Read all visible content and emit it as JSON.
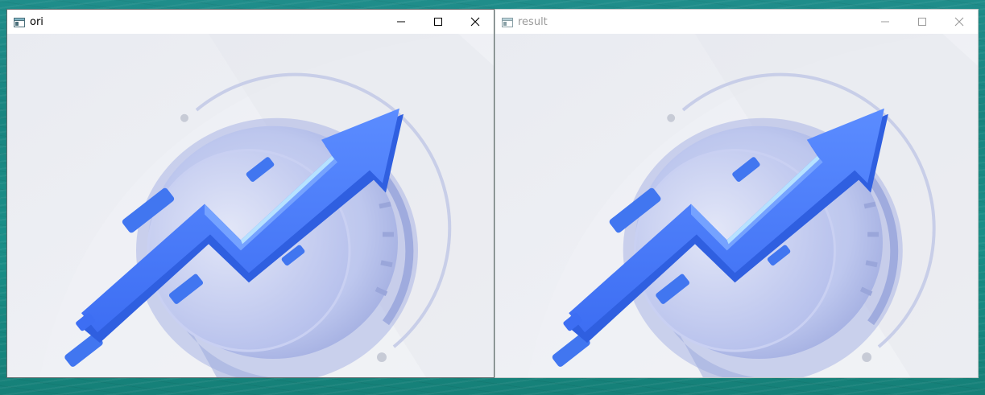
{
  "windows": [
    {
      "id": "ori",
      "title": "ori",
      "active": true,
      "buttons": [
        "minimize-icon",
        "maximize-icon",
        "close-icon"
      ],
      "content": "3d-upward-arrow-chart-illustration"
    },
    {
      "id": "result",
      "title": "result",
      "active": false,
      "buttons": [
        "minimize-icon",
        "maximize-icon",
        "close-icon"
      ],
      "content": "3d-upward-arrow-chart-illustration"
    }
  ],
  "colors": {
    "desktop": "#1a8a85",
    "window_bg": "#ffffff",
    "image_bg": "#eceef3",
    "arrow_blue": "#4a7cf7",
    "ring_lavender": "#b9c3ec"
  }
}
